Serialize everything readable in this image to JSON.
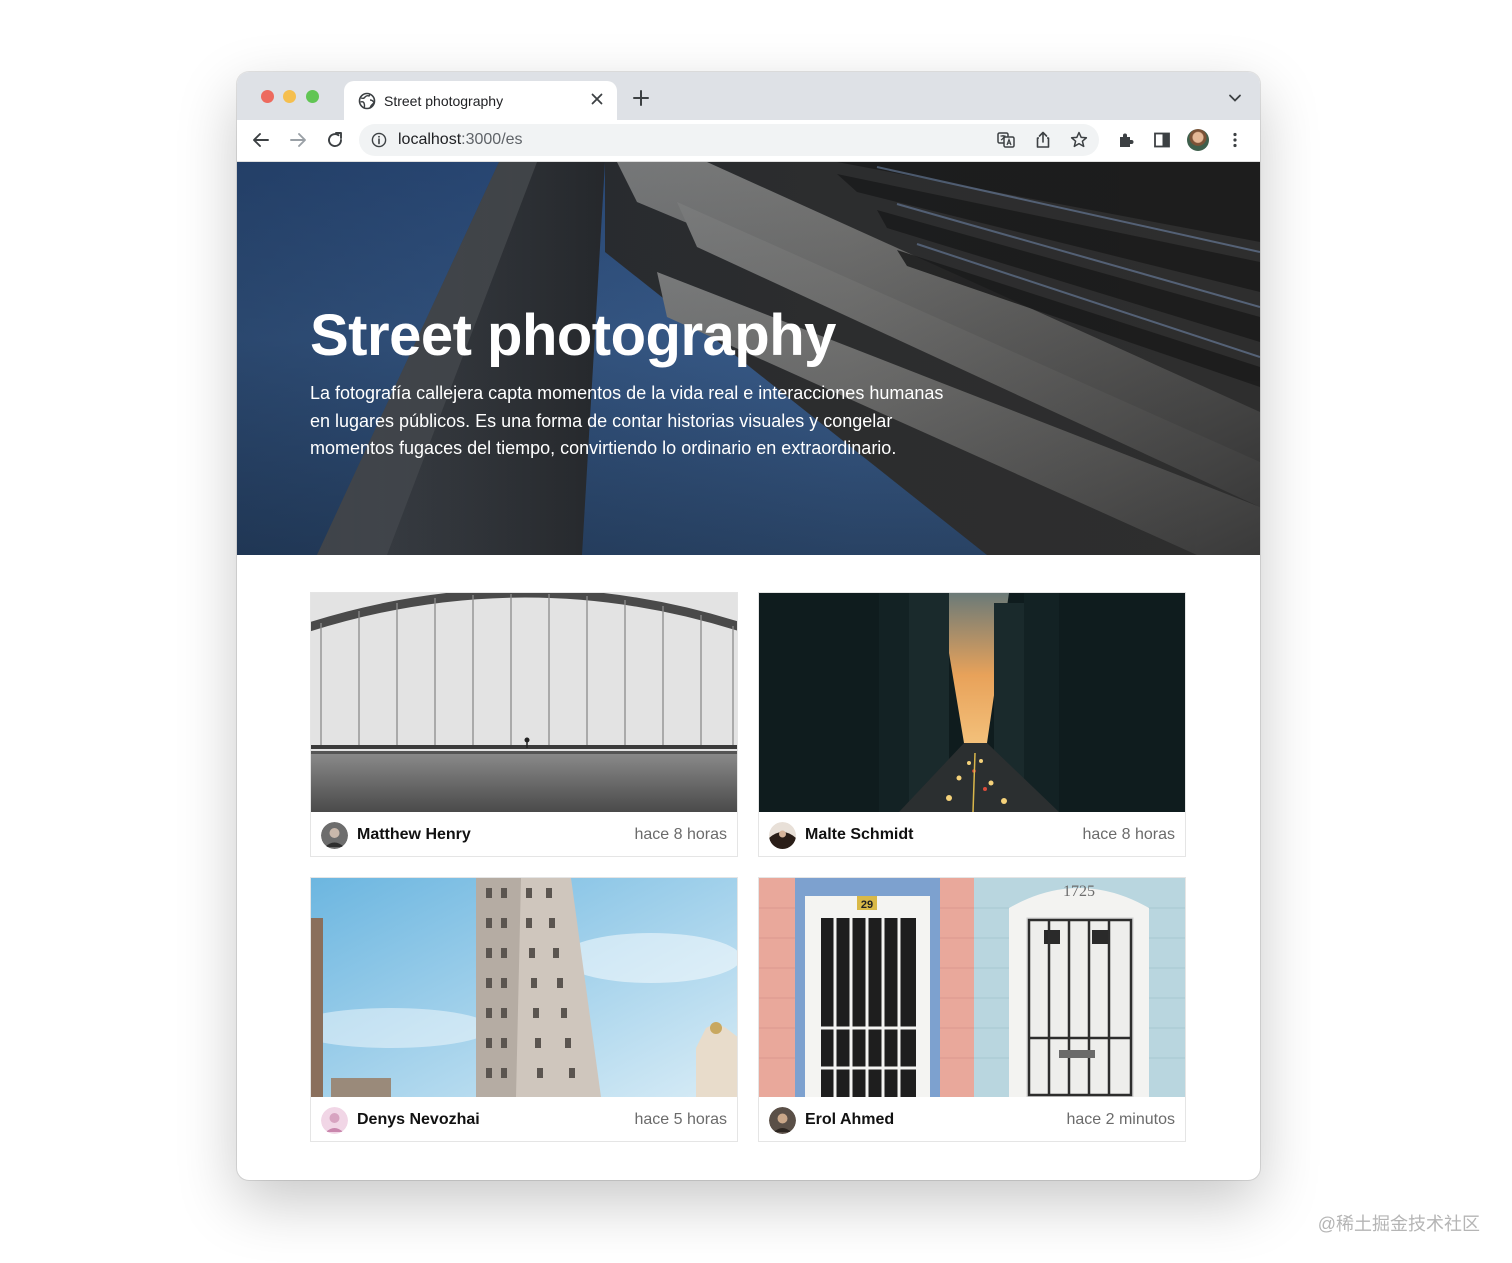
{
  "browser": {
    "tab_title": "Street photography",
    "url_host": "localhost",
    "url_path": ":3000/es"
  },
  "hero": {
    "title": "Street photography",
    "description": "La fotografía callejera capta momentos de la vida real e interacciones humanas en lugares públicos. Es una forma de contar historias visuales y congelar momentos fugaces del tiempo, convirtiendo lo ordinario en extraordinario."
  },
  "cards": [
    {
      "author": "Matthew Henry",
      "time": "hace 8 horas"
    },
    {
      "author": "Malte Schmidt",
      "time": "hace 8 horas"
    },
    {
      "author": "Denys Nevozhai",
      "time": "hace 5 horas"
    },
    {
      "author": "Erol Ahmed",
      "time": "hace 2 minutos",
      "door_number_left": "29",
      "door_number_right": "1725"
    }
  ],
  "watermark": "@稀土掘金技术社区",
  "colors": {
    "tab_strip": "#dee1e6",
    "hero_sky": "#2f5183",
    "traffic_red": "#ed6a5e",
    "traffic_yellow": "#f5bf4f",
    "traffic_green": "#61c554"
  },
  "icons": [
    "globe-icon",
    "close-icon",
    "plus-icon",
    "chevron-down-icon",
    "back-icon",
    "forward-icon",
    "reload-icon",
    "info-icon",
    "translate-icon",
    "share-icon",
    "star-icon",
    "extensions-icon",
    "side-panel-icon",
    "more-icon"
  ]
}
